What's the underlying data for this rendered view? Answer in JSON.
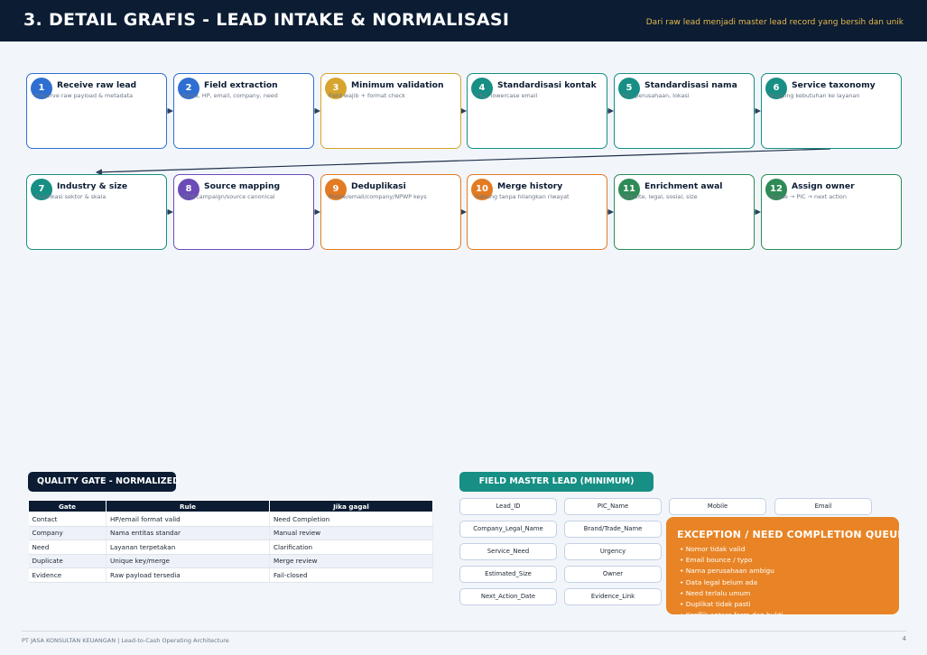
{
  "header": {
    "title": "3. DETAIL GRAFIS - LEAD INTAKE & NORMALISASI",
    "subtitle": "Dari raw lead menjadi master lead record yang bersih dan unik"
  },
  "steps": [
    {
      "num": "1",
      "title": "Receive raw lead",
      "desc": "Preserve raw payload & metadata",
      "color": "#2f6fd1"
    },
    {
      "num": "2",
      "title": "Field extraction",
      "desc": "Nama, HP, email, company, need",
      "color": "#2f6fd1"
    },
    {
      "num": "3",
      "title": "Minimum validation",
      "desc": "Field wajib + format check",
      "color": "#d7a52e"
    },
    {
      "num": "4",
      "title": "Standardisasi kontak",
      "desc": "+62, lowercase email",
      "color": "#178f84"
    },
    {
      "num": "5",
      "title": "Standardisasi nama",
      "desc": "PIC, perusahaan, lokasi",
      "color": "#178f84"
    },
    {
      "num": "6",
      "title": "Service taxonomy",
      "desc": "Mapping kebutuhan ke layanan",
      "color": "#178f84"
    },
    {
      "num": "7",
      "title": "Industry & size",
      "desc": "Klasifikasi sektor & skala",
      "color": "#178f84"
    },
    {
      "num": "8",
      "title": "Source mapping",
      "desc": "UTM/campaign/source canonical",
      "color": "#6a4bb8"
    },
    {
      "num": "9",
      "title": "Deduplikasi",
      "desc": "Phone/email/company/NPWP keys",
      "color": "#e37b22"
    },
    {
      "num": "10",
      "title": "Merge history",
      "desc": "Gabung tanpa hilangkan riwayat",
      "color": "#e37b22"
    },
    {
      "num": "11",
      "title": "Enrichment awal",
      "desc": "Website, legal, sosial, size",
      "color": "#2e8b57"
    },
    {
      "num": "12",
      "title": "Assign owner",
      "desc": "Queue → PIC → next action",
      "color": "#2e8b57"
    }
  ],
  "quality_gate": {
    "title": "QUALITY GATE - NORMALIZED",
    "title_color": "#0b1c33",
    "headers": [
      "Gate",
      "Rule",
      "Jika gagal"
    ],
    "rows": [
      [
        "Contact",
        "HP/email format valid",
        "Need Completion"
      ],
      [
        "Company",
        "Nama entitas standar",
        "Manual review"
      ],
      [
        "Need",
        "Layanan terpetakan",
        "Clarification"
      ],
      [
        "Duplicate",
        "Unique key/merge",
        "Merge review"
      ],
      [
        "Evidence",
        "Raw payload tersedia",
        "Fail-closed"
      ]
    ]
  },
  "field_master": {
    "title": "FIELD MASTER LEAD (MINIMUM)",
    "title_color": "#178f84",
    "fields": [
      "Lead_ID",
      "PIC_Name",
      "Mobile",
      "Email",
      "Company_Legal_Name",
      "Brand/Trade_Name",
      "Service_Need",
      "Urgency",
      "Estimated_Size",
      "Owner",
      "Next_Action_Date",
      "Evidence_Link"
    ]
  },
  "exception": {
    "title": "EXCEPTION / NEED COMPLETION QUEUE",
    "color": "#e88425",
    "items": [
      "Nomor tidak valid",
      "Email bounce / typo",
      "Nama perusahaan ambigu",
      "Data legal belum ada",
      "Need terlalu umum",
      "Duplikat tidak pasti",
      "Konflik antara form dan bukti"
    ]
  },
  "footer": {
    "text": "PT JASA KONSULTAN KEUANGAN | Lead-to-Cash Operating Architecture",
    "page": "4"
  }
}
